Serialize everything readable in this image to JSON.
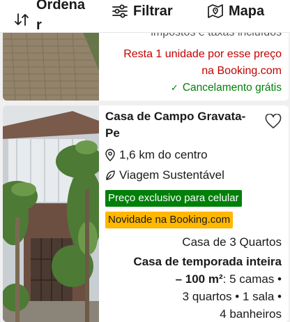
{
  "toolbar": {
    "sort_label": "Ordena",
    "sort_label_cont": "r",
    "filter_label": "Filtrar",
    "map_label": "Mapa"
  },
  "previous_card": {
    "taxes_note": "impostos e taxas incluídos",
    "urgency_1": "Resta 1 unidade por esse preço",
    "urgency_2": "na Booking.com",
    "cancellation": "Cancelamento grátis"
  },
  "property_card": {
    "title": "Casa de Campo Gravata-Pe",
    "distance": "1,6 km do centro",
    "sustainability": "Viagem Sustentável",
    "badge_mobile": "Preço exclusivo para celular",
    "badge_new": "Novidade na Booking.com",
    "unit_type": "Casa de 3 Quartos",
    "stay_type": "Casa de temporada inteira",
    "area": "– 100 m²",
    "beds": ": 5 camas •",
    "rooms": "3 quartos • 1 sala •",
    "baths": "4 banheiros"
  },
  "colors": {
    "urgency": "#c40000",
    "positive": "#008009",
    "badge_new": "#ffb700",
    "text": "#1a1a1a"
  },
  "icons": [
    "sort-arrows-icon",
    "filter-sliders-icon",
    "map-pin-icon",
    "check-icon",
    "heart-icon",
    "location-pin-icon",
    "leaf-icon"
  ]
}
